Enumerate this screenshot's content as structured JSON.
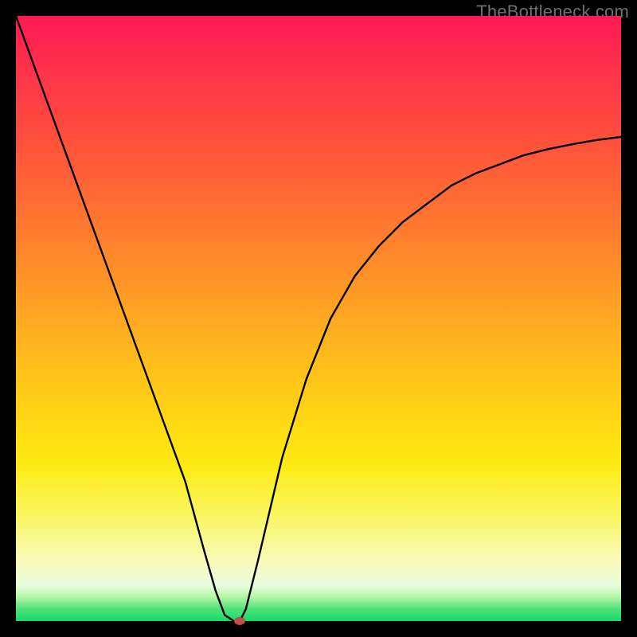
{
  "watermark": "TheBottleneck.com",
  "chart_data": {
    "type": "line",
    "title": "",
    "xlabel": "",
    "ylabel": "",
    "xlim": [
      0,
      100
    ],
    "ylim": [
      0,
      100
    ],
    "grid": false,
    "series": [
      {
        "name": "curve",
        "x": [
          0,
          4,
          8,
          12,
          16,
          20,
          24,
          28,
          31,
          33,
          34.5,
          36,
          37,
          38,
          40,
          44,
          48,
          52,
          56,
          60,
          64,
          68,
          72,
          76,
          80,
          84,
          88,
          92,
          96,
          100
        ],
        "y": [
          100,
          89,
          78,
          67,
          56,
          45,
          34,
          23,
          12,
          5,
          1,
          0,
          0,
          2,
          10,
          27,
          40,
          50,
          57,
          62,
          66,
          69,
          72,
          74,
          75.5,
          77,
          78,
          78.8,
          79.5,
          80
        ]
      }
    ],
    "marker": {
      "x": 37,
      "y": 0,
      "color": "#c0504a"
    },
    "background_gradient": {
      "stops": [
        {
          "pos": 0,
          "color": "#ff1a55"
        },
        {
          "pos": 54,
          "color": "#ffb41f"
        },
        {
          "pos": 82,
          "color": "#faf55c"
        },
        {
          "pos": 100,
          "color": "#16d86a"
        }
      ]
    }
  }
}
